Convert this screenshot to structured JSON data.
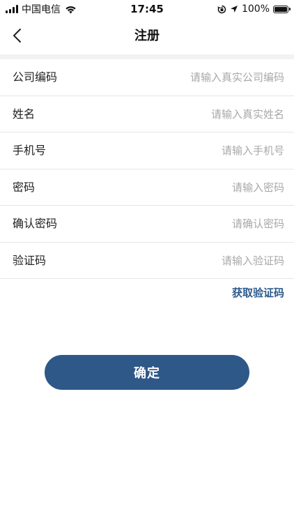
{
  "status_bar": {
    "carrier": "中国电信",
    "time": "17:45",
    "battery": "100%",
    "icons": [
      "signal-bars-icon",
      "wifi-icon",
      "orientation-lock-icon",
      "location-arrow-icon",
      "battery-icon"
    ]
  },
  "nav": {
    "title": "注册",
    "back_icon": "chevron-left-icon"
  },
  "form": {
    "fields": [
      {
        "label": "公司编码",
        "placeholder": "请输入真实公司编码",
        "value": ""
      },
      {
        "label": "姓名",
        "placeholder": "请输入真实姓名",
        "value": ""
      },
      {
        "label": "手机号",
        "placeholder": "请输入手机号",
        "value": ""
      },
      {
        "label": "密码",
        "placeholder": "请输入密码",
        "value": ""
      },
      {
        "label": "确认密码",
        "placeholder": "请确认密码",
        "value": ""
      },
      {
        "label": "验证码",
        "placeholder": "请输入验证码",
        "value": ""
      }
    ],
    "get_code_label": "获取验证码",
    "confirm_label": "确定"
  },
  "colors": {
    "primary": "#2e5887",
    "link": "#2d5a8c",
    "placeholder": "#a8a8a8",
    "divider": "#e6e6e6",
    "section_bg": "#f2f2f2"
  }
}
